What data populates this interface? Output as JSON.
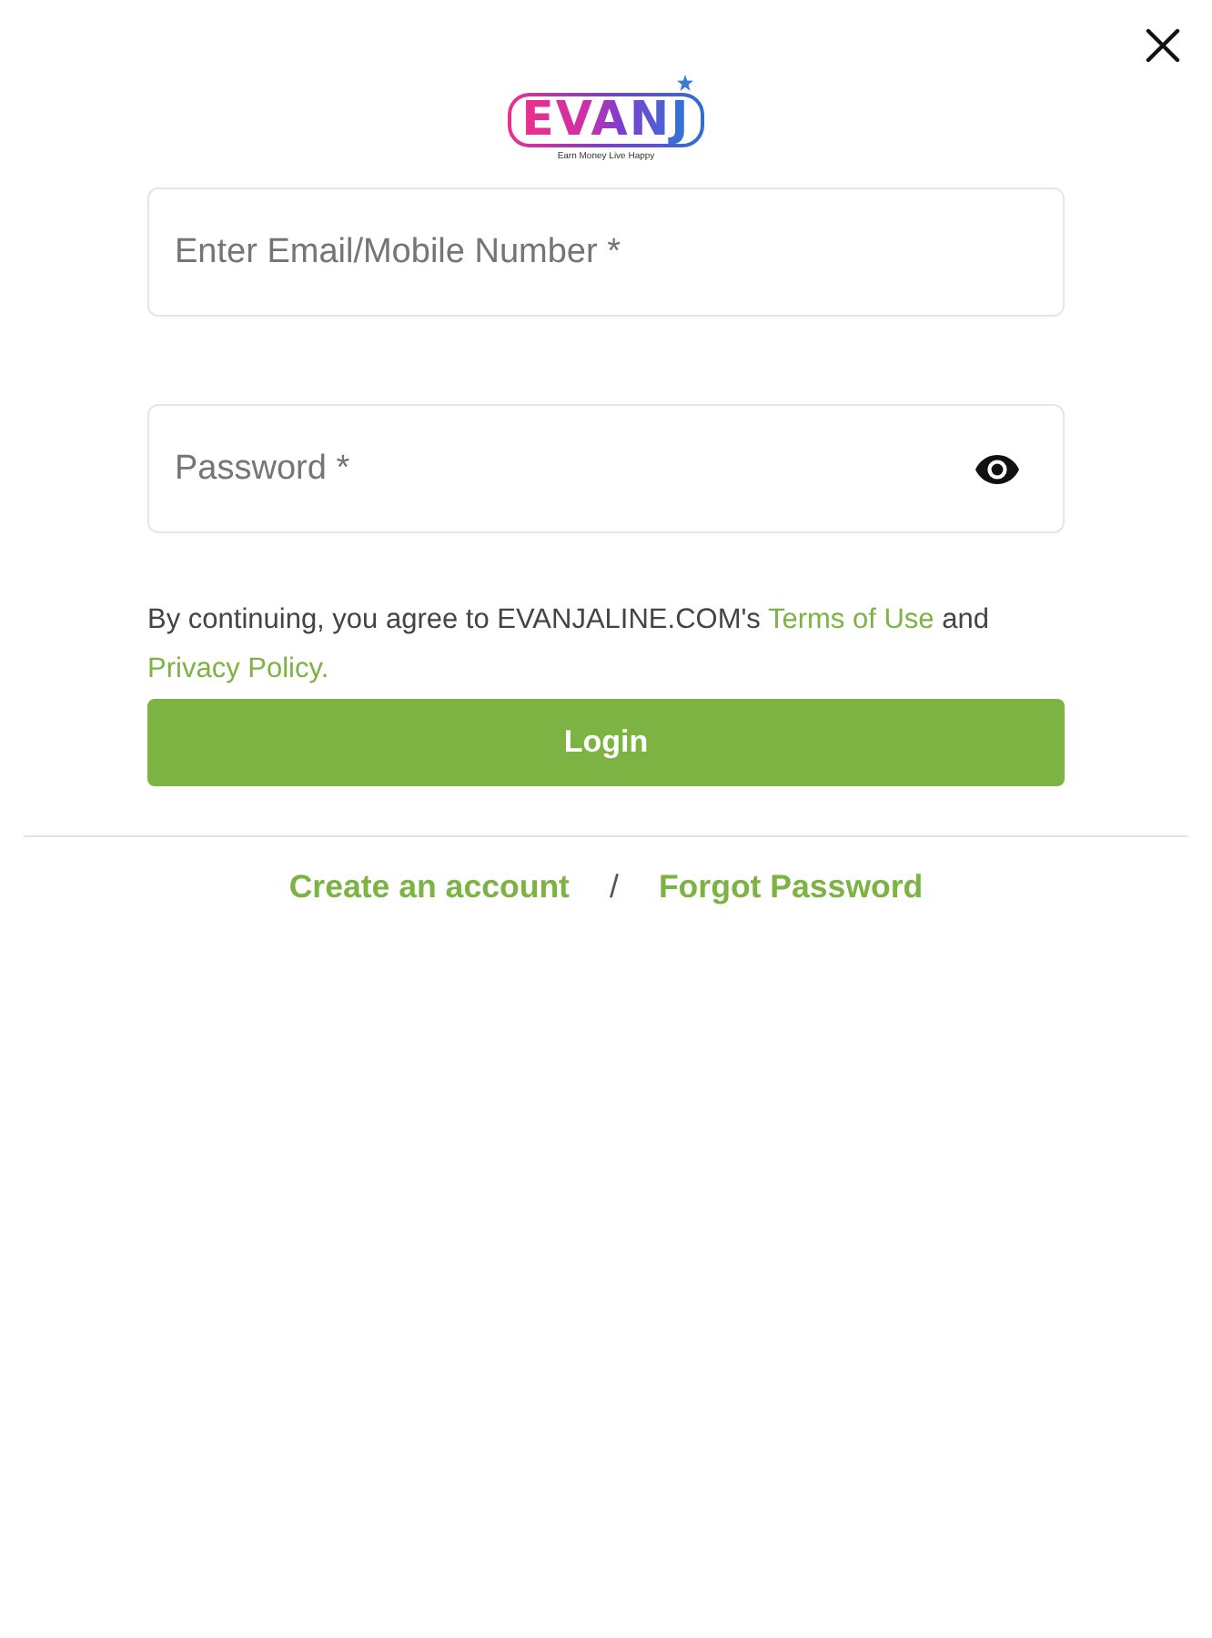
{
  "logo": {
    "text": "EVANJ",
    "tagline": "Earn Money Live Happy"
  },
  "fields": [
    {
      "kind": "text",
      "placeholder": "Enter Email/Mobile Number *"
    },
    {
      "kind": "password",
      "placeholder": "Password *"
    }
  ],
  "consent": {
    "before": "By continuing, you agree to EVANJALINE.COM's",
    "terms_link": "Terms of Use",
    "between": "and",
    "privacy_link": "Privacy Policy."
  },
  "login_button": "Login",
  "footer_links": [
    {
      "label": "Create an account"
    },
    {
      "label": "Forgot Password"
    }
  ],
  "separator": "/"
}
